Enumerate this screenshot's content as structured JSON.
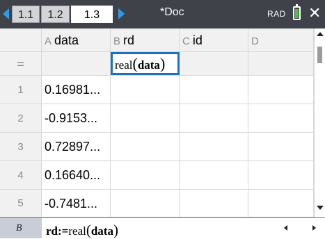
{
  "tabs": [
    "1.1",
    "1.2",
    "1.3"
  ],
  "active_tab": "1.3",
  "doc_title": "*Doc",
  "angle_mode": "RAD",
  "columns": [
    {
      "letter": "A",
      "name": "data"
    },
    {
      "letter": "B",
      "name": "rd"
    },
    {
      "letter": "C",
      "name": "id"
    },
    {
      "letter": "D",
      "name": ""
    }
  ],
  "formula_row": {
    "label": "=",
    "b_formula_fn": "real",
    "b_formula_arg": "data"
  },
  "rows": [
    {
      "index": "1",
      "a": "0.16981..."
    },
    {
      "index": "2",
      "a": "-0.9153..."
    },
    {
      "index": "3",
      "a": "0.72897..."
    },
    {
      "index": "4",
      "a": "0.16640..."
    },
    {
      "index": "5",
      "a": "-0.7481..."
    }
  ],
  "entry_line": {
    "cell_ref": "B",
    "var": "rd:=",
    "fn": "real",
    "arg": "data"
  },
  "colors": {
    "topbar": "#3f4249",
    "tab_arrow": "#2f9be8",
    "selection": "#1e6fc0",
    "battery": "#49c73b"
  },
  "icons": [
    "tab-left-arrow-icon",
    "tab-right-arrow-icon",
    "battery-icon",
    "close-icon",
    "scroll-up-icon",
    "scroll-down-icon",
    "cursor-left-icon",
    "cursor-right-icon"
  ]
}
